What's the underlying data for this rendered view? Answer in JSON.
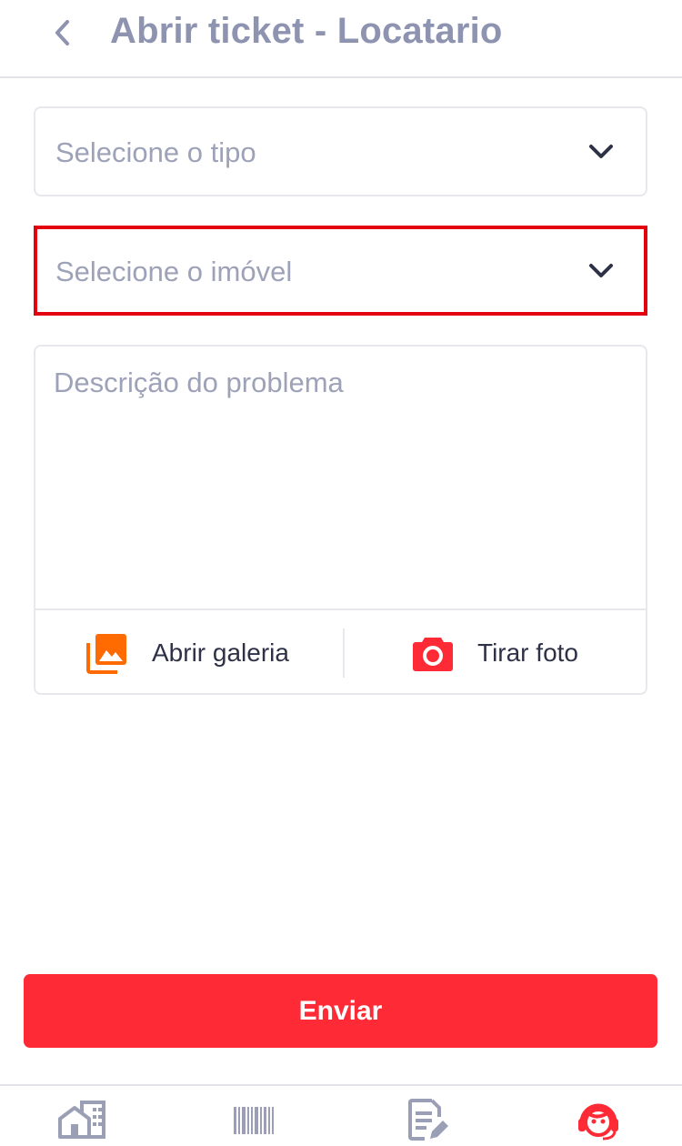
{
  "header": {
    "title": "Abrir ticket - Locatario",
    "back_icon": "chevron-left-icon"
  },
  "form": {
    "tipo_select": {
      "placeholder": "Selecione o tipo",
      "icon": "chevron-down-icon"
    },
    "imovel_select": {
      "placeholder": "Selecione o imóvel",
      "icon": "chevron-down-icon",
      "highlighted": true,
      "highlight_color": "#e3000f"
    },
    "description": {
      "placeholder": "Descrição do problema",
      "value": "",
      "gallery_label": "Abrir galeria",
      "gallery_icon": "photo-library-icon",
      "camera_label": "Tirar foto",
      "camera_icon": "camera-icon"
    },
    "submit_label": "Enviar"
  },
  "tabbar": {
    "items": [
      {
        "name": "properties",
        "icon": "buildings-icon",
        "active": false
      },
      {
        "name": "boletos",
        "icon": "barcode-icon",
        "active": false
      },
      {
        "name": "contracts",
        "icon": "document-edit-icon",
        "active": false
      },
      {
        "name": "support",
        "icon": "support-agent-icon",
        "active": true
      }
    ]
  },
  "colors": {
    "primary": "#fe2b36",
    "title": "#8e93b0",
    "placeholder": "#9da2b8",
    "gallery_icon": "#ff6b00",
    "camera_icon": "#fe2b36",
    "tab_inactive": "#9a9fb5",
    "tab_active": "#fe2b36"
  }
}
